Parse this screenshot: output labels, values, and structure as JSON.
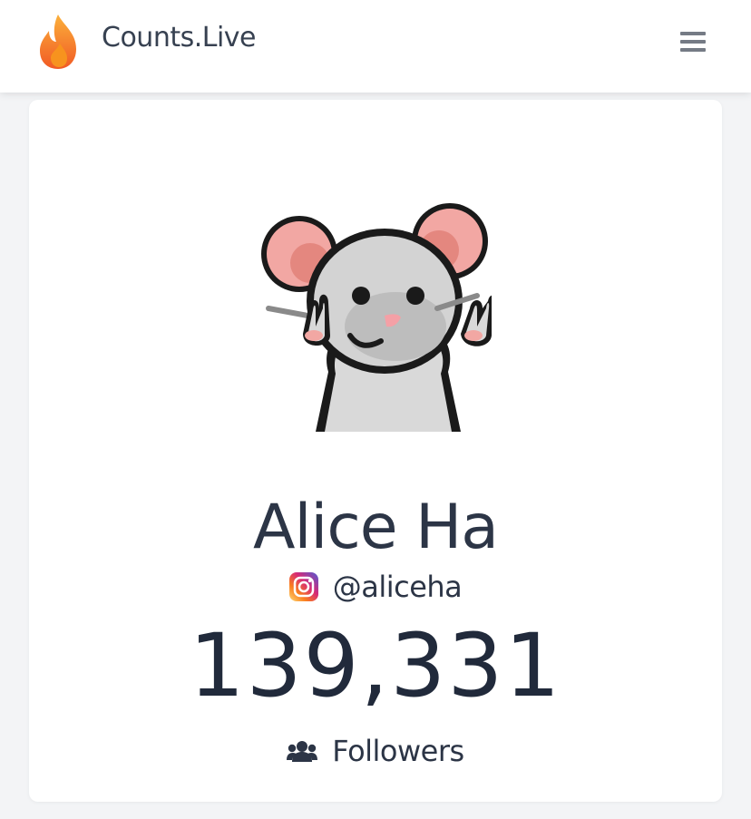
{
  "header": {
    "brand_name": "Counts.Live",
    "brand_icon": "flame-icon",
    "menu_icon": "hamburger-menu-icon"
  },
  "profile": {
    "avatar_icon": "mouse-avatar-image",
    "name": "Alice Ha",
    "platform_icon": "instagram-icon",
    "handle": "@aliceha",
    "count": "139,331",
    "count_icon": "users-icon",
    "count_label": "Followers"
  },
  "colors": {
    "text_primary": "#2c3546",
    "flame_orange": "#f7931e",
    "menu_gray": "#757b85",
    "background": "#f3f4f6"
  }
}
